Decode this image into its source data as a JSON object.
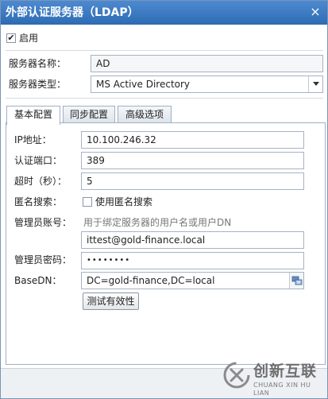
{
  "dialog": {
    "title": "外部认证服务器（LDAP）",
    "close_glyph": "×"
  },
  "enable": {
    "label": "启用",
    "checked": true,
    "check_glyph": "✔"
  },
  "server": {
    "name_label": "服务器名称：",
    "name_value": "AD",
    "type_label": "服务器类型：",
    "type_value": "MS Active Directory"
  },
  "tabs": [
    {
      "label": "基本配置",
      "active": true
    },
    {
      "label": "同步配置",
      "active": false
    },
    {
      "label": "高级选项",
      "active": false
    }
  ],
  "basic": {
    "ip_label": "IP地址：",
    "ip_value": "10.100.246.32",
    "port_label": "认证端口：",
    "port_value": "389",
    "timeout_label": "超时（秒）：",
    "timeout_value": "5",
    "anon_label": "匿名搜索：",
    "anon_checkbox_label": "使用匿名搜索",
    "anon_checked": false,
    "admin_label": "管理员账号：",
    "admin_hint": "用于绑定服务器的用户名或用户DN",
    "admin_value": "ittest@gold-finance.local",
    "password_label": "管理员密码：",
    "password_value": "••••••••",
    "basedn_label": "BaseDN：",
    "basedn_value": "DC=gold-finance,DC=local",
    "test_button": "测试有效性"
  },
  "watermark": {
    "cn": "创新互联",
    "en": "CHUANG XIN HU LIAN"
  }
}
